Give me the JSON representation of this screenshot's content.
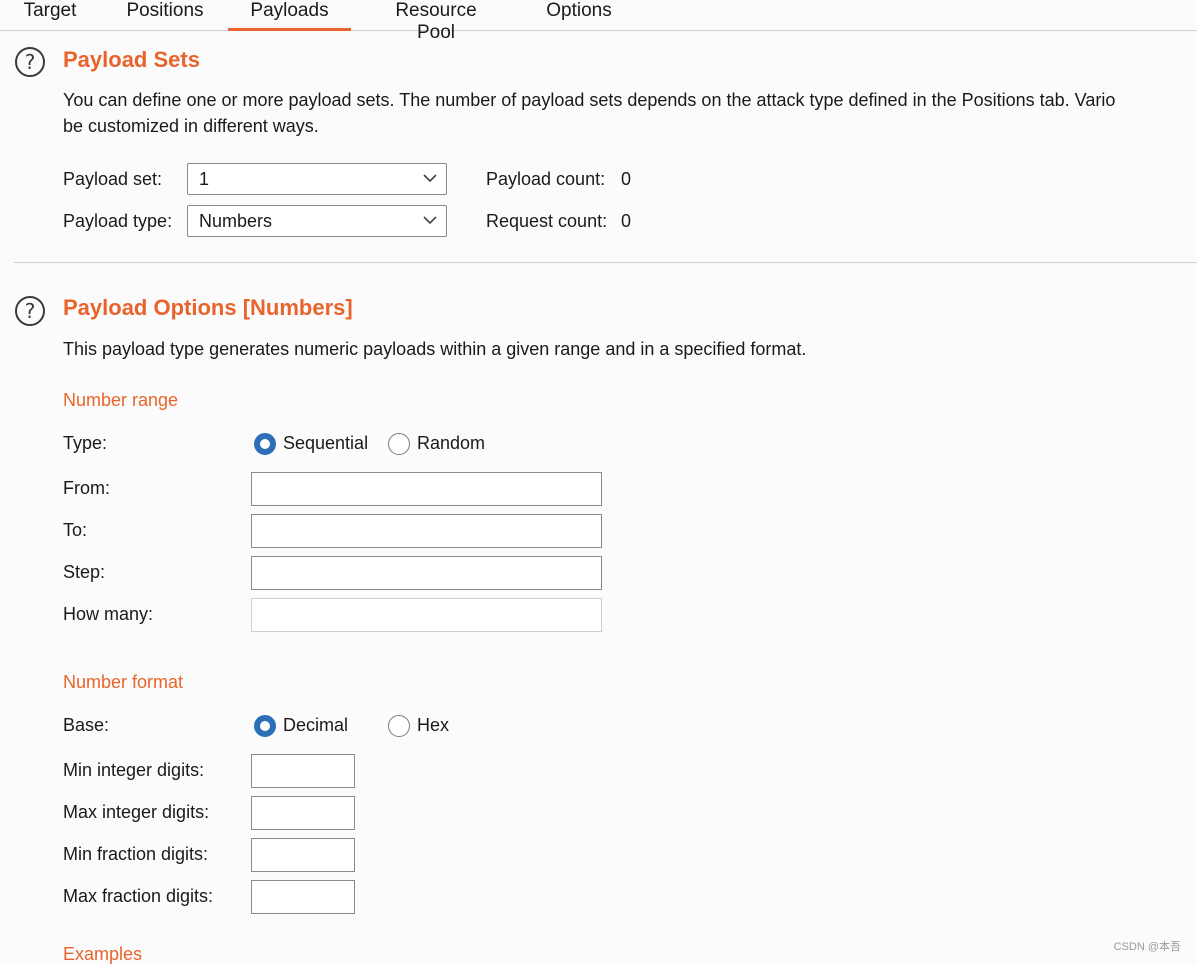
{
  "tabs": [
    {
      "label": "Target",
      "active": false
    },
    {
      "label": "Positions",
      "active": false
    },
    {
      "label": "Payloads",
      "active": true
    },
    {
      "label": "Resource Pool",
      "active": false
    },
    {
      "label": "Options",
      "active": false
    }
  ],
  "payload_sets": {
    "title": "Payload Sets",
    "description_line1": "You can define one or more payload sets. The number of payload sets depends on the attack type defined in the Positions tab. Vario",
    "description_line2": "be customized in different ways.",
    "set_label": "Payload set:",
    "set_value": "1",
    "type_label": "Payload type:",
    "type_value": "Numbers",
    "payload_count_label": "Payload count:",
    "payload_count": "0",
    "request_count_label": "Request count:",
    "request_count": "0"
  },
  "payload_options": {
    "title": "Payload Options [Numbers]",
    "description": "This payload type generates numeric payloads within a given range and in a specified format.",
    "number_range": {
      "heading": "Number range",
      "type_label": "Type:",
      "sequential_label": "Sequential",
      "random_label": "Random",
      "selected": "Sequential",
      "from_label": "From:",
      "from_value": "",
      "to_label": "To:",
      "to_value": "",
      "step_label": "Step:",
      "step_value": "",
      "how_many_label": "How many:",
      "how_many_value": ""
    },
    "number_format": {
      "heading": "Number format",
      "base_label": "Base:",
      "decimal_label": "Decimal",
      "hex_label": "Hex",
      "selected": "Decimal",
      "min_int_label": "Min integer digits:",
      "max_int_label": "Max integer digits:",
      "min_frac_label": "Min fraction digits:",
      "max_frac_label": "Max fraction digits:"
    },
    "examples_heading": "Examples"
  },
  "watermark": "CSDN @本吾",
  "colors": {
    "accent": "#e8642c",
    "radio_selected": "#2c6fb7"
  }
}
